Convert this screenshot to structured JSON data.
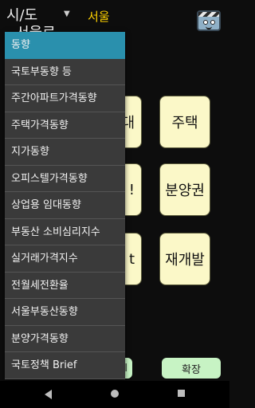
{
  "header": {
    "region_label": "시/도",
    "region_value": "서울",
    "under_label": "서울로"
  },
  "tiles": {
    "row1_left": "대",
    "row1_right": "주택",
    "row2_left": "!",
    "row2_right": "분양권",
    "row3_left": "t",
    "row3_right": "재개발"
  },
  "bottom": {
    "left_button": "l",
    "expand_button": "확장"
  },
  "menu": {
    "items": [
      "동향",
      "국토부동향 등",
      "주간아파트가격동향",
      "주택가격동향",
      "지가동향",
      "오피스텔가격동향",
      "상업용 임대동향",
      "부동산 소비심리지수",
      "실거래가격지수",
      "전월세전환율",
      "서울부동산동향",
      "분양가격동향",
      "국토정책 Brief"
    ],
    "selected_index": 0
  },
  "colors": {
    "tile_bg": "#fbf8c8",
    "menu_bg": "#3a3a3a",
    "menu_selected": "#2a90ad",
    "region_value": "#ffd200",
    "bottom_button": "#c7f3c4"
  }
}
